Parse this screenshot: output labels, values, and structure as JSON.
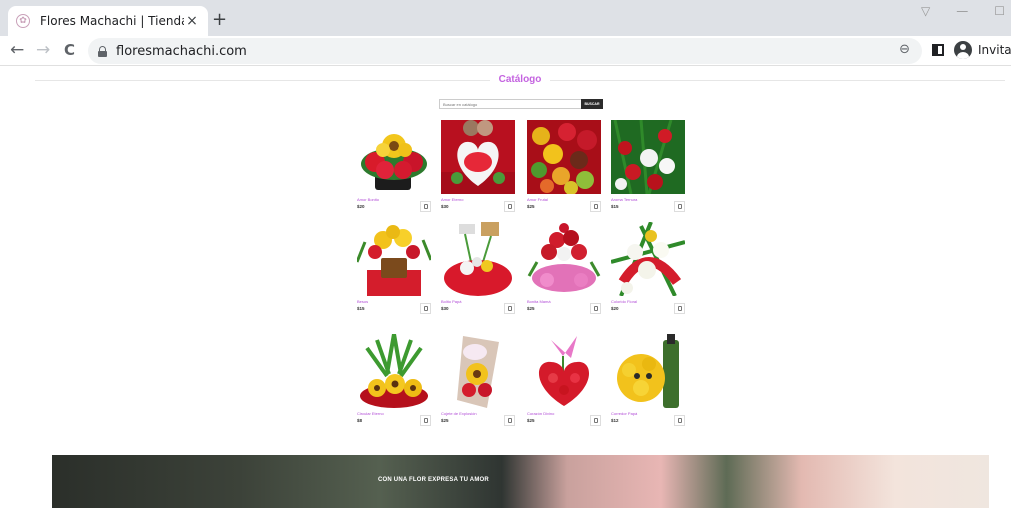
{
  "browser": {
    "tab_title": "Flores Machachi | Tienda Online",
    "tab_close": "×",
    "new_tab": "+",
    "url": "floresmachachi.com",
    "profile": "Invitado",
    "back": "←",
    "forward": "→",
    "reload": "C",
    "zoom": "⊖",
    "controls": [
      "▽",
      "—",
      "☐"
    ]
  },
  "catalog": {
    "title": "Catálogo",
    "search_placeholder": "Buscar en catálogo",
    "search_button": "BUSCAR"
  },
  "products": [
    {
      "name": "Amor Bonito",
      "price": "$20",
      "icon": "bouquet-photo"
    },
    {
      "name": "Amor Eterno",
      "price": "$30",
      "icon": "bouquet-photo"
    },
    {
      "name": "Amor Frutal",
      "price": "$25",
      "icon": "bouquet-photo"
    },
    {
      "name": "Aroma Ternura",
      "price": "$15",
      "icon": "bouquet-photo"
    },
    {
      "name": "Besos",
      "price": "$15",
      "icon": "bouquet-photo"
    },
    {
      "name": "Bolito Papá",
      "price": "$30",
      "icon": "bouquet-photo"
    },
    {
      "name": "Bonita Mamá",
      "price": "$25",
      "icon": "bouquet-photo"
    },
    {
      "name": "Colorido Floral",
      "price": "$20",
      "icon": "bouquet-photo"
    },
    {
      "name": "Circular Eterno",
      "price": "$8",
      "icon": "bouquet-photo"
    },
    {
      "name": "Cojete de Explosión",
      "price": "$25",
      "icon": "bouquet-photo"
    },
    {
      "name": "Corazón Divino",
      "price": "$25",
      "icon": "bouquet-photo"
    },
    {
      "name": "Corredor Papá",
      "price": "$12",
      "icon": "bouquet-photo"
    }
  ],
  "banner": {
    "text": "CON UNA FLOR EXPRESA TU AMOR"
  },
  "colors": {
    "accent": "#c463e0",
    "product_name": "#b14bd6",
    "search_button": "#2b2b2b"
  }
}
